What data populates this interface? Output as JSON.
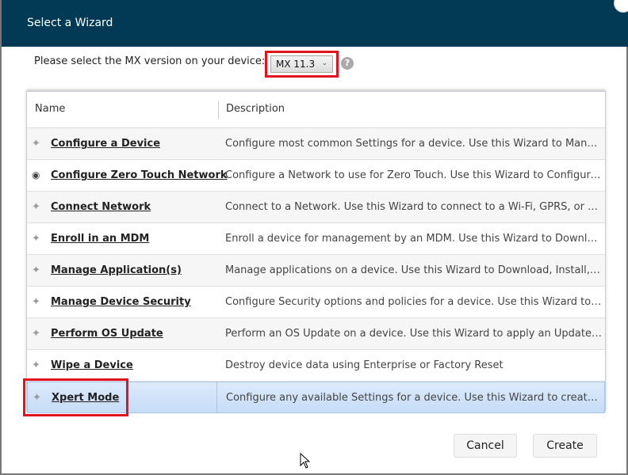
{
  "dialog": {
    "title": "Select a Wizard"
  },
  "mx": {
    "label": "Please select the MX version on your device:",
    "selected": "MX 11.3",
    "help": "?"
  },
  "table": {
    "columns": [
      "Name",
      "Description"
    ],
    "rows": [
      {
        "icon": "magic-wand-icon",
        "name": "Configure a Device",
        "description": "Configure most common Settings for a device. Use this Wizard to Manage..."
      },
      {
        "icon": "android-icon",
        "name": "Configure Zero Touch Network",
        "description": "Configure a Network to use for Zero Touch. Use this Wizard to Configure a..."
      },
      {
        "icon": "magic-wand-icon",
        "name": "Connect Network",
        "description": "Connect to a Network. Use this Wizard to connect to a Wi-Fi, GPRS, or Ethe..."
      },
      {
        "icon": "magic-wand-icon",
        "name": "Enroll in an MDM",
        "description": "Enroll a device for management by an MDM.  Use this Wizard to Download,..."
      },
      {
        "icon": "magic-wand-icon",
        "name": "Manage Application(s)",
        "description": "Manage applications on a device.  Use this Wizard to Download, Install, Uni..."
      },
      {
        "icon": "magic-wand-icon",
        "name": "Manage Device Security",
        "description": "Configure Security options and policies for a device.  Use this Wizard to Wh..."
      },
      {
        "icon": "magic-wand-icon",
        "name": "Perform OS Update",
        "description": "Perform an OS Update on a device.  Use this Wizard to apply an Update or..."
      },
      {
        "icon": "magic-wand-icon",
        "name": "Wipe a Device",
        "description": "Destroy device data using Enterprise or Factory Reset"
      },
      {
        "icon": "magic-wand-icon",
        "name": "Xpert Mode",
        "description": "Configure any available Settings for a device. Use this Wizard to create any...",
        "selected": true
      }
    ]
  },
  "buttons": {
    "cancel": "Cancel",
    "create": "Create"
  },
  "colors": {
    "titlebar": "#023a56",
    "highlight": "#e0131f",
    "selection": "#c6dcf7"
  }
}
